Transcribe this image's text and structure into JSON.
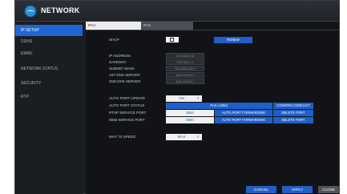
{
  "window": {
    "title": "NETWORK",
    "icon": "network-globe-icon"
  },
  "sidebar": {
    "items": [
      {
        "label": "IP SETUP",
        "active": true
      },
      {
        "label": "DDNS",
        "active": false
      },
      {
        "label": "EMAIL",
        "active": false
      },
      {
        "label": "NETWORK STATUS",
        "active": false
      },
      {
        "label": "SECURITY",
        "active": false
      },
      {
        "label": "RTP",
        "active": false
      }
    ]
  },
  "tabs": [
    {
      "label": "IPv4",
      "active": true
    },
    {
      "label": "IPv6",
      "active": false
    }
  ],
  "form": {
    "dhcp": {
      "label": "DHCP",
      "renew_label": "RENEW"
    },
    "ip_address": {
      "label": "IP ADDRESS",
      "value": "192.168.4.38"
    },
    "gateway": {
      "label": "GATEWAY",
      "value": "192.168.4.1"
    },
    "subnet_mask": {
      "label": "SUBNET MASK",
      "value": "255.255.255.0"
    },
    "dns1": {
      "label": "1ST DNS SERVER",
      "value": "168.126.63.1"
    },
    "dns2": {
      "label": "2ND DNS SERVER",
      "value": "168.126.63.2"
    },
    "auto_port_update": {
      "label": "AUTO PORT UPDATE",
      "value": "ON"
    },
    "auto_port_status": {
      "label": "AUTO PORT STATUS",
      "value": "Port conflict",
      "confirm_label": "CONFIRM CONFLICT"
    },
    "rtsp_port": {
      "label": "RTSP SERVICE PORT",
      "value": "5554",
      "forward_label": "AUTO PORT FORWARDING",
      "delete_label": "DELETE PORT"
    },
    "web_port": {
      "label": "WEB SERVICE PORT",
      "value": "8080",
      "forward_label": "AUTO PORT FORWARDING",
      "delete_label": "DELETE PORT"
    },
    "max_tx_speed": {
      "label": "MAX TX SPEED",
      "value": "MAX"
    }
  },
  "footer": {
    "cancel": "CANCEL",
    "apply": "APPLY",
    "close": "CLOSE"
  },
  "colors": {
    "accent": "#1f5fc7",
    "sidebar_active": "#1f66d0",
    "background": "#111317"
  }
}
